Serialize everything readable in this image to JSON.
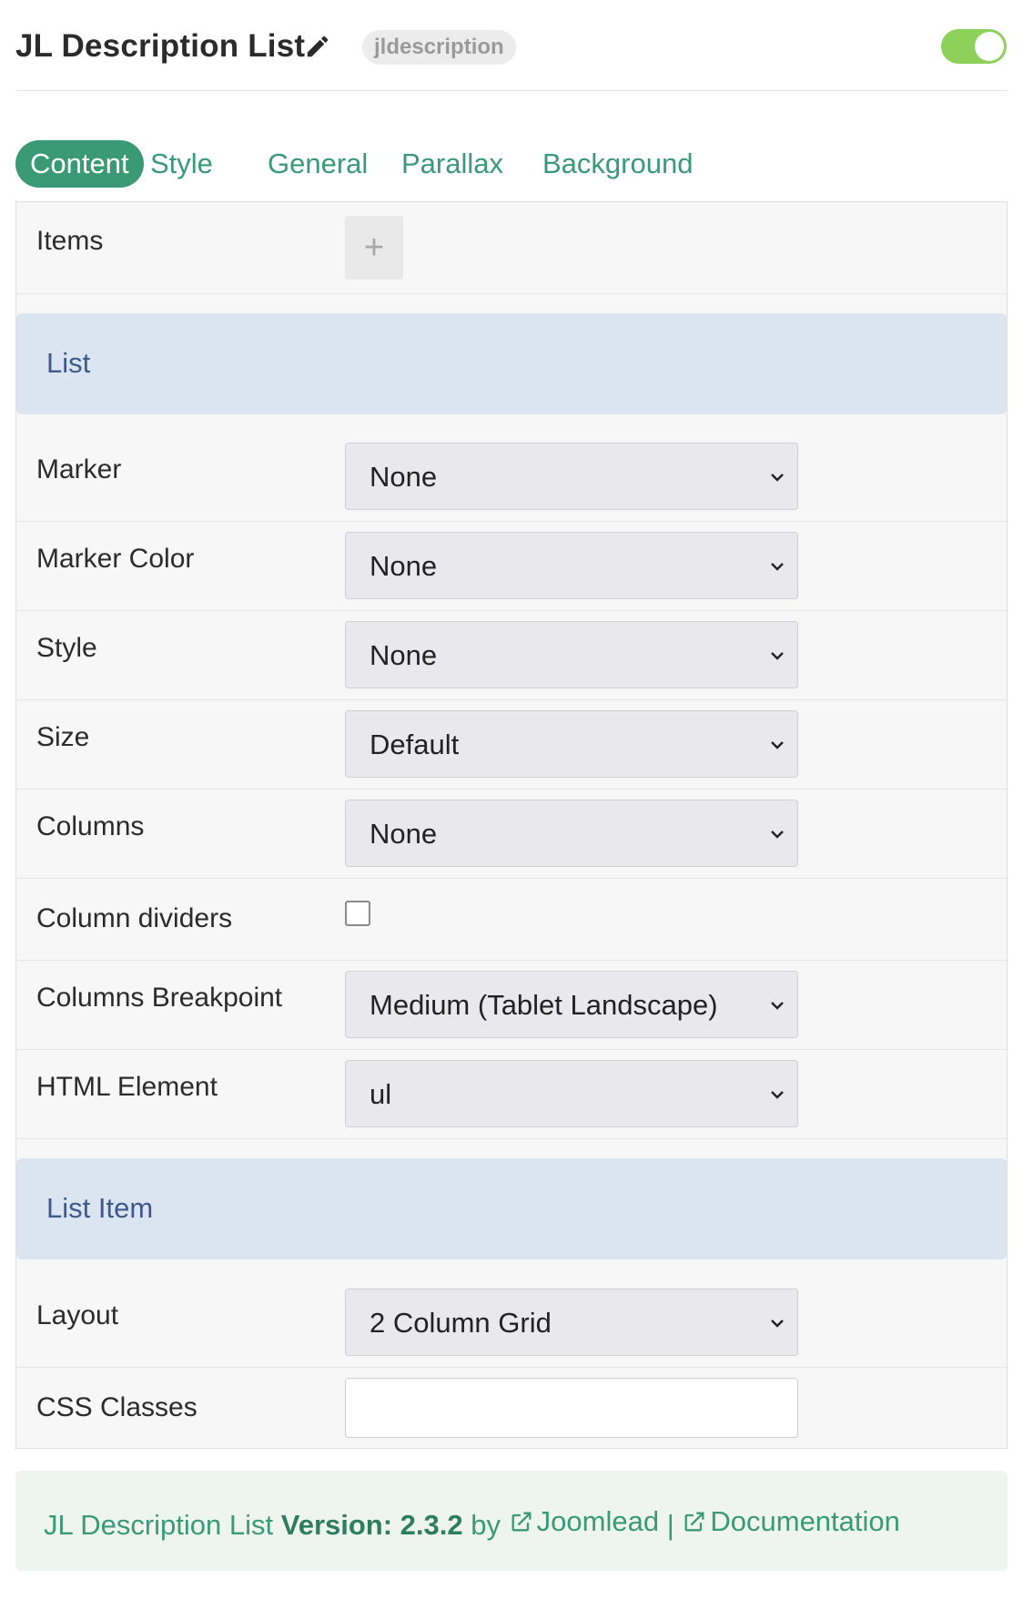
{
  "header": {
    "title": "JL Description List",
    "tag": "jldescription",
    "toggle_on": true,
    "toggle_color": "#8dd05a"
  },
  "tabs": [
    {
      "label": "Content",
      "active": true
    },
    {
      "label": "Style",
      "active": false
    },
    {
      "label": "General",
      "active": false
    },
    {
      "label": "Parallax",
      "active": false
    },
    {
      "label": "Background",
      "active": false
    }
  ],
  "items": {
    "label": "Items",
    "add_symbol": "+"
  },
  "sections": {
    "list": {
      "title": "List",
      "fields": [
        {
          "label": "Marker",
          "type": "select",
          "value": "None"
        },
        {
          "label": "Marker Color",
          "type": "select",
          "value": "None"
        },
        {
          "label": "Style",
          "type": "select",
          "value": "None"
        },
        {
          "label": "Size",
          "type": "select",
          "value": "Default"
        },
        {
          "label": "Columns",
          "type": "select",
          "value": "None"
        },
        {
          "label": "Column dividers",
          "type": "checkbox",
          "checked": false
        },
        {
          "label": "Columns Breakpoint",
          "type": "select",
          "value": "Medium (Tablet Landscape)"
        },
        {
          "label": "HTML Element",
          "type": "select",
          "value": "ul"
        }
      ]
    },
    "list_item": {
      "title": "List Item",
      "fields": [
        {
          "label": "Layout",
          "type": "select",
          "value": "2 Column Grid"
        },
        {
          "label": "CSS Classes",
          "type": "text",
          "value": ""
        }
      ]
    }
  },
  "footer": {
    "name": "JL Description List",
    "version_label": "Version: 2.3.2",
    "by": "by",
    "link1": "Joomlead",
    "separator": "|",
    "link2": "Documentation"
  },
  "colors": {
    "accent": "#3a9a78",
    "section_bg": "#dbe4f1",
    "footer_bg": "#eef5f1"
  }
}
